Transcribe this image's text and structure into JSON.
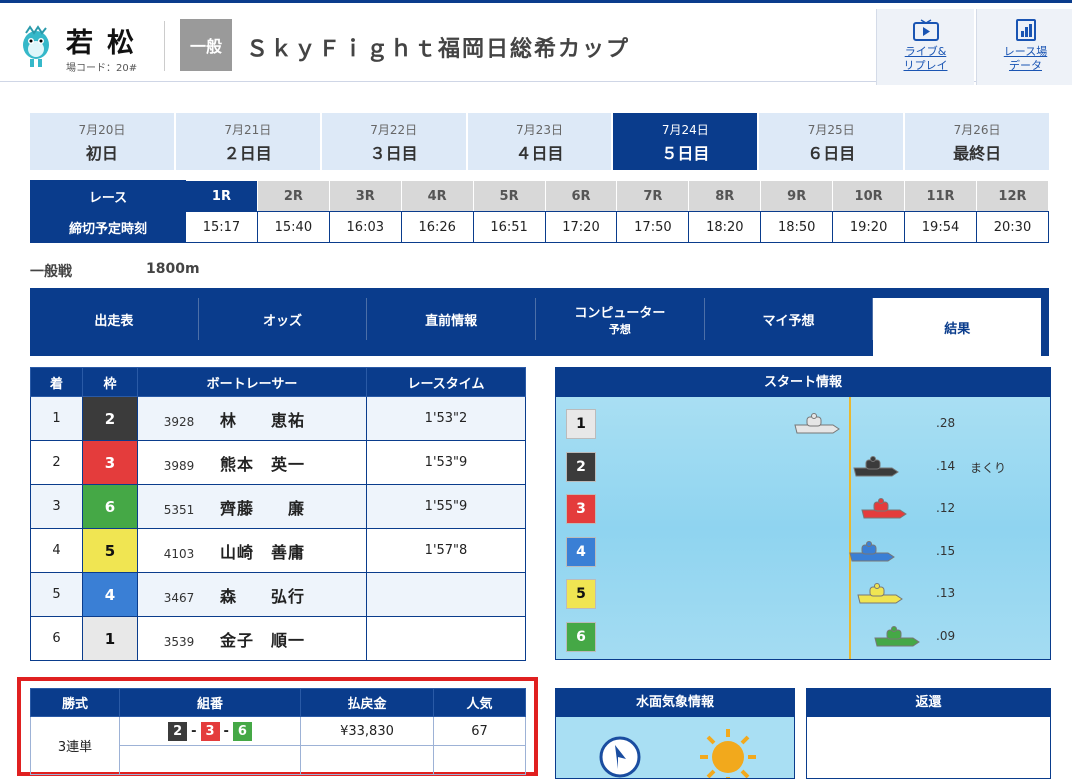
{
  "header": {
    "venue_name": "若松",
    "venue_code": "場コード：20#",
    "grade": "一般",
    "race_title": "ＳｋｙＦｉｇｈｔ福岡日総希カップ",
    "live_link": [
      "ライブ&",
      "リプレイ"
    ],
    "data_link": [
      "レース場",
      "データ"
    ]
  },
  "days": [
    {
      "date": "7月20日",
      "name": "初日",
      "active": false
    },
    {
      "date": "7月21日",
      "name": "２日目",
      "active": false
    },
    {
      "date": "7月22日",
      "name": "３日目",
      "active": false
    },
    {
      "date": "7月23日",
      "name": "４日目",
      "active": false
    },
    {
      "date": "7月24日",
      "name": "５日目",
      "active": true
    },
    {
      "date": "7月25日",
      "name": "６日目",
      "active": false
    },
    {
      "date": "7月26日",
      "name": "最終日",
      "active": false
    }
  ],
  "races": {
    "race_label": "レース",
    "deadline_label": "締切予定時刻",
    "numbers": [
      "1R",
      "2R",
      "3R",
      "4R",
      "5R",
      "6R",
      "7R",
      "8R",
      "9R",
      "10R",
      "11R",
      "12R"
    ],
    "times": [
      "15:17",
      "15:40",
      "16:03",
      "16:26",
      "16:51",
      "17:20",
      "17:50",
      "18:20",
      "18:50",
      "19:20",
      "19:54",
      "20:30"
    ],
    "active_index": 0
  },
  "race_meta": {
    "class": "一般戦",
    "distance": "1800m"
  },
  "content_tabs": [
    {
      "label": "出走表",
      "sub": ""
    },
    {
      "label": "オッズ",
      "sub": ""
    },
    {
      "label": "直前情報",
      "sub": ""
    },
    {
      "label": "コンピューター",
      "sub": "予想"
    },
    {
      "label": "マイ予想",
      "sub": ""
    },
    {
      "label": "結果",
      "sub": "",
      "active": true
    }
  ],
  "result": {
    "headers": [
      "着",
      "枠",
      "ボートレーサー",
      "レースタイム"
    ],
    "rows": [
      {
        "pos": "1",
        "frame": "2",
        "id": "3928",
        "name": "林　　恵祐",
        "time": "1'53\"2"
      },
      {
        "pos": "2",
        "frame": "3",
        "id": "3989",
        "name": "熊本　英一",
        "time": "1'53\"9"
      },
      {
        "pos": "3",
        "frame": "6",
        "id": "5351",
        "name": "齊藤　　廉",
        "time": "1'55\"9"
      },
      {
        "pos": "4",
        "frame": "5",
        "id": "4103",
        "name": "山崎　善庸",
        "time": "1'57\"8"
      },
      {
        "pos": "5",
        "frame": "4",
        "id": "3467",
        "name": "森　　弘行",
        "time": ""
      },
      {
        "pos": "6",
        "frame": "1",
        "id": "3539",
        "name": "金子　順一",
        "time": ""
      }
    ]
  },
  "start_info": {
    "title": "スタート情報",
    "rows": [
      {
        "frame": "1",
        "st": ".28",
        "tech": "",
        "boat_color": "#e6e6e6"
      },
      {
        "frame": "2",
        "st": ".14",
        "tech": "まくり",
        "boat_color": "#3b3b3b"
      },
      {
        "frame": "3",
        "st": ".12",
        "tech": "",
        "boat_color": "#e43c3c"
      },
      {
        "frame": "4",
        "st": ".15",
        "tech": "",
        "boat_color": "#3a7fd5"
      },
      {
        "frame": "5",
        "st": ".13",
        "tech": "",
        "boat_color": "#f0e552"
      },
      {
        "frame": "6",
        "st": ".09",
        "tech": "",
        "boat_color": "#45a846"
      }
    ]
  },
  "payout": {
    "headers": [
      "勝式",
      "組番",
      "払戻金",
      "人気"
    ],
    "bet_type": "3連単",
    "combo": [
      "2",
      "3",
      "6"
    ],
    "amount": "¥33,830",
    "popularity": "67"
  },
  "weather": {
    "title": "水面気象情報"
  },
  "refund": {
    "title": "返還"
  }
}
